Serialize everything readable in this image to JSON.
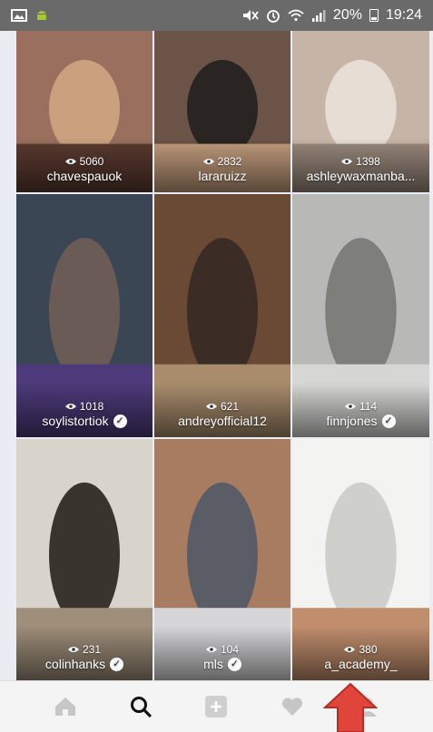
{
  "status_bar": {
    "battery": "20%",
    "time": "19:24",
    "icons": [
      "gallery-icon",
      "android-icon",
      "mute-icon",
      "alarm-icon",
      "wifi-icon",
      "signal-icon",
      "battery-icon"
    ]
  },
  "tiles": [
    {
      "views": "5060",
      "username": "chavespauok",
      "verified": false,
      "colors": [
        "#9a6f5d",
        "#caa07f",
        "#5b3b30"
      ]
    },
    {
      "views": "2832",
      "username": "lararuizz",
      "verified": false,
      "colors": [
        "#6b5347",
        "#2a2523",
        "#c49e7e"
      ]
    },
    {
      "views": "1398",
      "username": "ashleywaxmanba...",
      "verified": false,
      "colors": [
        "#c6b5a6",
        "#e8ddd4",
        "#9b8a7d"
      ]
    },
    {
      "views": "1018",
      "username": "soylistortiok",
      "verified": true,
      "colors": [
        "#3a4653",
        "#6b5b57",
        "#4d3a7a"
      ]
    },
    {
      "views": "621",
      "username": "andreyofficial12",
      "verified": false,
      "colors": [
        "#6a4a35",
        "#3b2c26",
        "#a88c6c"
      ]
    },
    {
      "views": "114",
      "username": "finnjones",
      "verified": true,
      "colors": [
        "#b8b8b6",
        "#7e7e7b",
        "#d6d6d4"
      ]
    },
    {
      "views": "231",
      "username": "colinhanks",
      "verified": true,
      "colors": [
        "#d8d4cc",
        "#3a342e",
        "#9e8e7a"
      ]
    },
    {
      "views": "104",
      "username": "mls",
      "verified": true,
      "colors": [
        "#a77c60",
        "#5a5d66",
        "#d6d6d8"
      ]
    },
    {
      "views": "380",
      "username": "a_academy_",
      "verified": false,
      "colors": [
        "#f3f3f1",
        "#cfcfcc",
        "#c08e6d"
      ]
    }
  ],
  "nav": {
    "items": [
      "home-icon",
      "search-icon",
      "add-icon",
      "heart-icon",
      "profile-icon"
    ],
    "active": "search-icon"
  }
}
